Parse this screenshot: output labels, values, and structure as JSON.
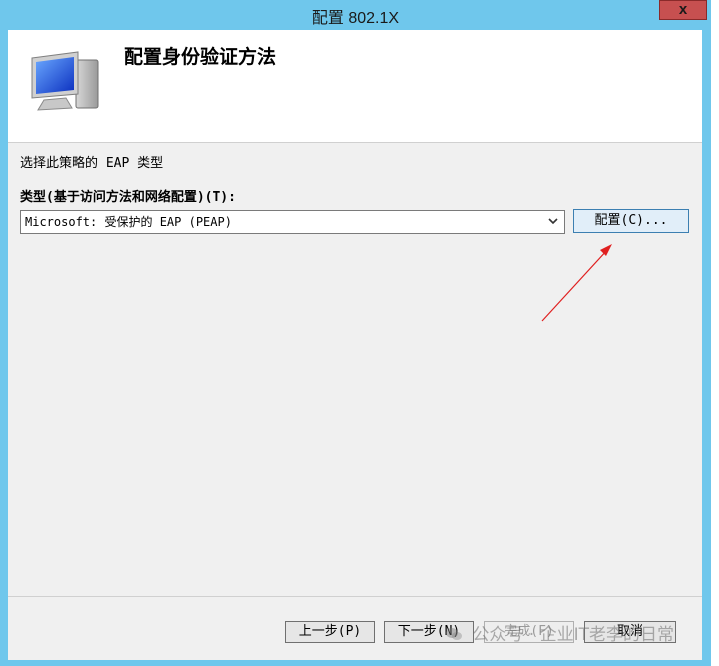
{
  "window": {
    "title": "配置 802.1X",
    "close_label": "x"
  },
  "header": {
    "title": "配置身份验证方法",
    "icon": "computer-monitor-icon"
  },
  "content": {
    "prompt": "选择此策略的 EAP 类型",
    "type_label": "类型(基于访问方法和网络配置)(T):",
    "eap_selected": "Microsoft: 受保护的 EAP (PEAP)",
    "config_button": "配置(C)..."
  },
  "footer": {
    "back": "上一步(P)",
    "next": "下一步(N)",
    "finish": "完成(F)",
    "cancel": "取消"
  },
  "watermark": "公众号 · 企业IT老李的日常",
  "colors": {
    "titlebar": "#6fc7ec",
    "close": "#c75050",
    "accent_border": "#3c7fb1",
    "annotation_arrow": "#e02020"
  }
}
